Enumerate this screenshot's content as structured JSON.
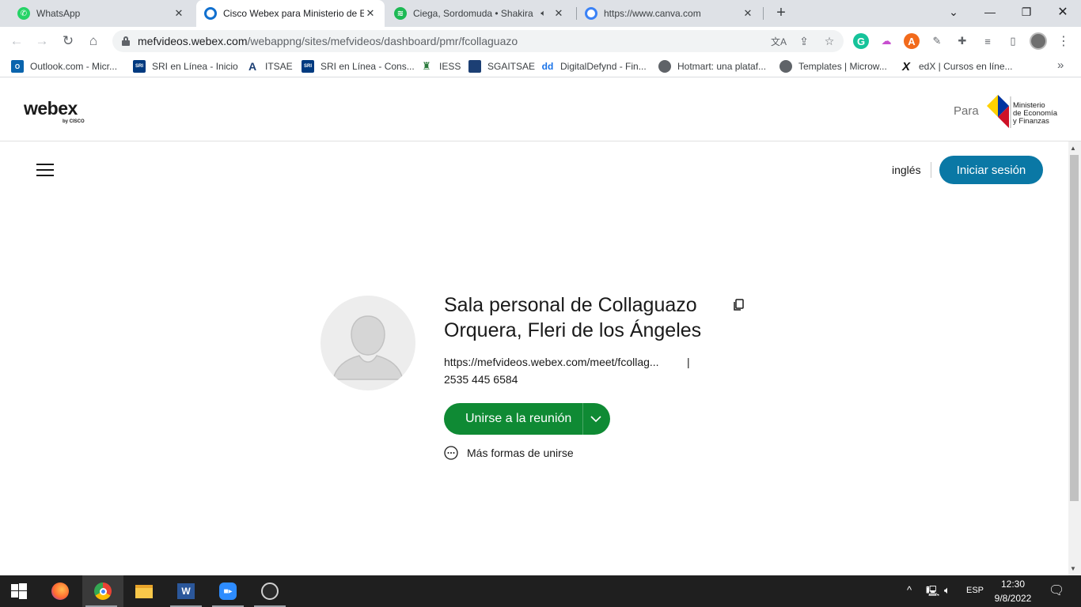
{
  "browser": {
    "tabs": [
      {
        "title": "WhatsApp",
        "favicon": "whatsapp-icon",
        "active": false,
        "color": "#25d366"
      },
      {
        "title": "Cisco Webex para Ministerio de E",
        "favicon": "webex-icon",
        "active": true,
        "color": "#1170cf"
      },
      {
        "title": "Ciega, Sordomuda • Shakira",
        "favicon": "spotify-icon",
        "active": false,
        "color": "#1db954"
      },
      {
        "title": "https://www.canva.com",
        "favicon": "canva-icon",
        "active": false,
        "color": "#3b82f6"
      }
    ],
    "new_tab_symbol": "+",
    "address": {
      "host": "mefvideos.webex.com",
      "path": "/webappng/sites/mefvideos/dashboard/pmr/fcollaguazo"
    },
    "bookmarks": [
      {
        "label": "Outlook.com - Micr...",
        "icon": "outlook-icon",
        "color": "#0a64ad",
        "glyph": "O"
      },
      {
        "label": "SRI en Línea - Inicio",
        "icon": "sri-icon",
        "color": "#003a80",
        "glyph": "SRI"
      },
      {
        "label": "ITSAE",
        "icon": "itsae-icon",
        "color": "#1c3f74",
        "glyph": "A"
      },
      {
        "label": "SRI en Línea - Cons...",
        "icon": "sri-icon",
        "color": "#003a80",
        "glyph": "SRI"
      },
      {
        "label": "IESS",
        "icon": "iess-icon",
        "color": "#2a7a3b",
        "glyph": "I"
      },
      {
        "label": "SGAITSAE",
        "icon": "sgaitsae-icon",
        "color": "#1c3f74",
        "glyph": "S"
      },
      {
        "label": "DigitalDefynd - Fin...",
        "icon": "digitaldefynd-icon",
        "color": "#1a73e8",
        "glyph": "dd"
      },
      {
        "label": "Hotmart: una plataf...",
        "icon": "globe-icon",
        "color": "#5f6368",
        "glyph": ""
      },
      {
        "label": "Templates | Microw...",
        "icon": "globe-icon",
        "color": "#5f6368",
        "glyph": ""
      },
      {
        "label": "edX | Cursos en líne...",
        "icon": "edx-icon",
        "color": "#111111",
        "glyph": "X"
      }
    ]
  },
  "header": {
    "brand": "webex",
    "brand_sub": "by CISCO",
    "para_label": "Para",
    "org_name": "Ministerio\nde Economía\ny Finanzas"
  },
  "topbar": {
    "language": "inglés",
    "signin_label": "Iniciar sesión"
  },
  "room": {
    "title": "Sala personal de Collaguazo Orquera, Fleri de los Ángeles",
    "link": "https://mefvideos.webex.com/meet/fcollag...",
    "link_sep": "|",
    "number": "2535 445 6584",
    "join_label": "Unirse a la reunión",
    "more_ways_label": "Más formas de unirse"
  },
  "taskbar": {
    "apps": [
      "start-icon",
      "firefox-icon",
      "chrome-icon",
      "file-explorer-icon",
      "word-icon",
      "zoom-icon",
      "obs-icon"
    ],
    "language": "ESP",
    "time": "12:30",
    "date": "9/8/2022"
  },
  "colors": {
    "accent_blue": "#0a78a5",
    "join_green": "#0f8a34"
  }
}
